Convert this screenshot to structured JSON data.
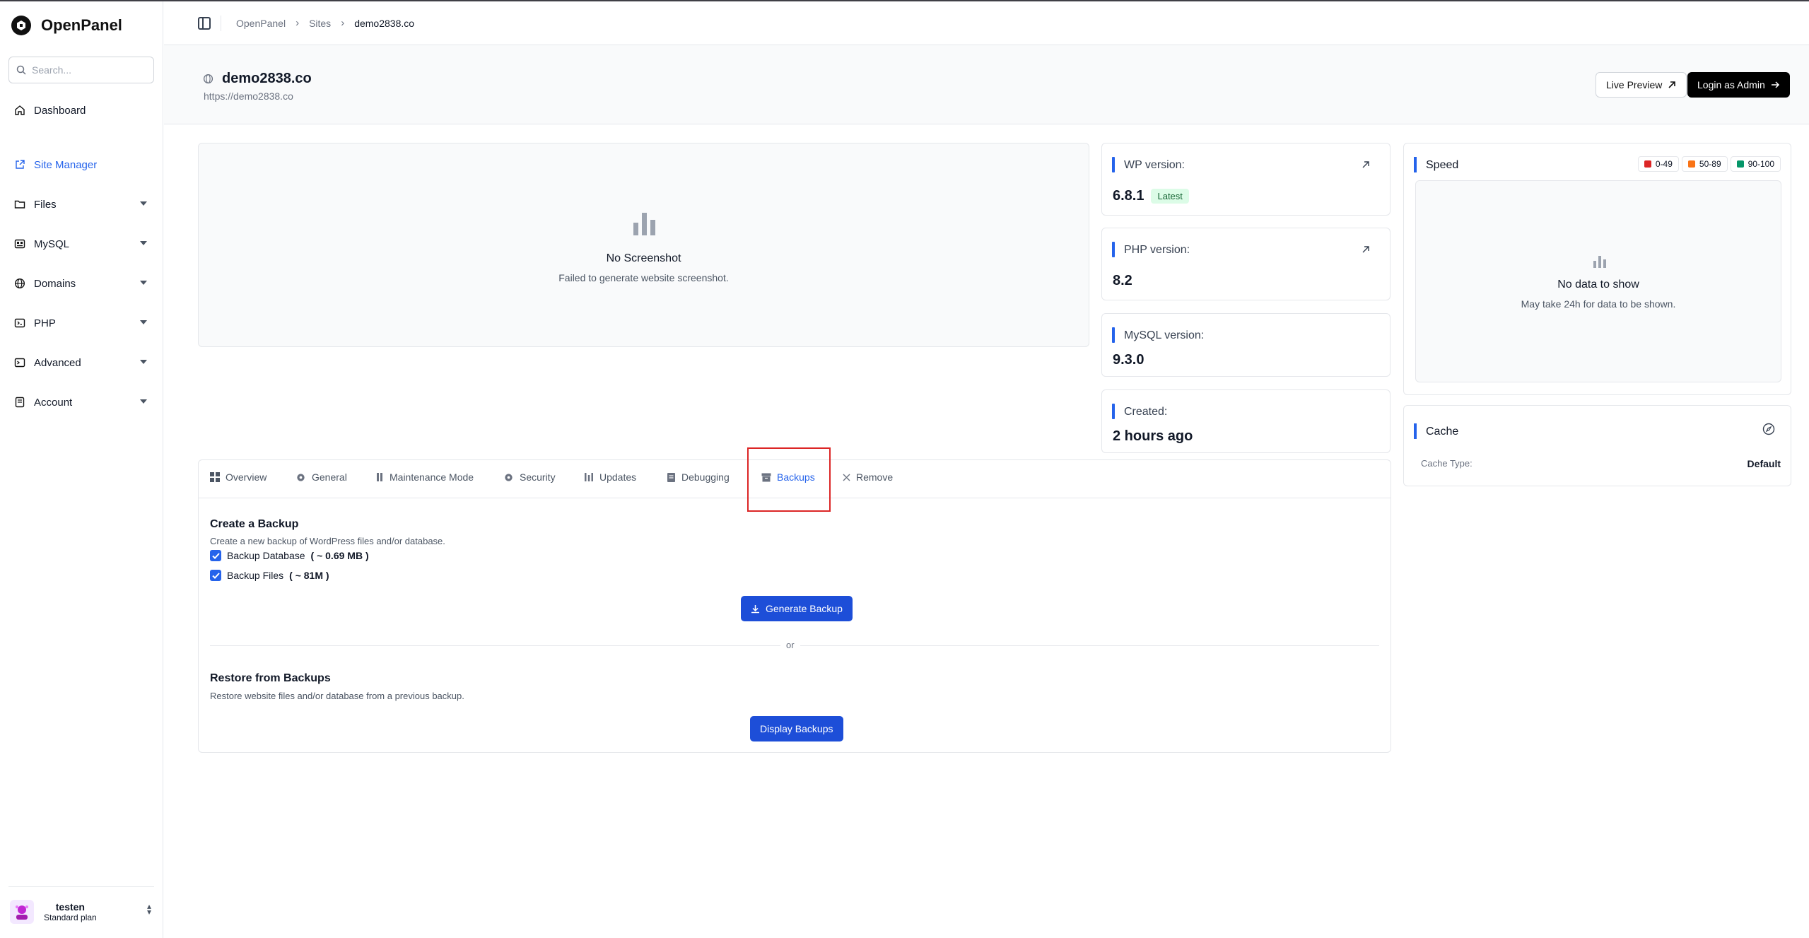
{
  "brand": {
    "name": "OpenPanel"
  },
  "search": {
    "placeholder": "Search..."
  },
  "sidebar": {
    "items": [
      {
        "label": "Dashboard"
      },
      {
        "label": "Site Manager"
      },
      {
        "label": "Files"
      },
      {
        "label": "MySQL"
      },
      {
        "label": "Domains"
      },
      {
        "label": "PHP"
      },
      {
        "label": "Advanced"
      },
      {
        "label": "Account"
      }
    ]
  },
  "user": {
    "name": "testen",
    "plan": "Standard plan"
  },
  "breadcrumb": [
    "OpenPanel",
    "Sites",
    "demo2838.co"
  ],
  "site": {
    "name": "demo2838.co",
    "url": "https://demo2838.co",
    "live_preview": "Live Preview",
    "login_admin": "Login as Admin"
  },
  "screenshot": {
    "title": "No Screenshot",
    "subtitle": "Failed to generate website screenshot."
  },
  "cards": {
    "wp": {
      "label": "WP version:",
      "value": "6.8.1",
      "badge": "Latest"
    },
    "php": {
      "label": "PHP version:",
      "value": "8.2"
    },
    "mysql": {
      "label": "MySQL version:",
      "value": "9.3.0"
    },
    "created": {
      "label": "Created:",
      "value": "2 hours ago"
    }
  },
  "speed": {
    "label": "Speed",
    "legend": [
      "0-49",
      "50-89",
      "90-100"
    ],
    "legend_colors": [
      "#dc2626",
      "#f97316",
      "#059669"
    ],
    "empty_title": "No data to show",
    "empty_sub": "May take 24h for data to be shown."
  },
  "cache": {
    "label": "Cache",
    "key": "Cache Type:",
    "value": "Default"
  },
  "tabs": [
    {
      "label": "Overview"
    },
    {
      "label": "General"
    },
    {
      "label": "Maintenance Mode"
    },
    {
      "label": "Security"
    },
    {
      "label": "Updates"
    },
    {
      "label": "Debugging"
    },
    {
      "label": "Backups"
    },
    {
      "label": "Remove"
    }
  ],
  "backup": {
    "create_title": "Create a Backup",
    "create_desc": "Create a new backup of WordPress files and/or database.",
    "db_label": "Backup Database",
    "db_size": "( ~ 0.69 MB )",
    "files_label": "Backup Files",
    "files_size": "( ~ 81M )",
    "generate_btn": "Generate Backup",
    "or": "or",
    "restore_title": "Restore from Backups",
    "restore_desc": "Restore website files and/or database from a previous backup.",
    "display_btn": "Display Backups"
  }
}
